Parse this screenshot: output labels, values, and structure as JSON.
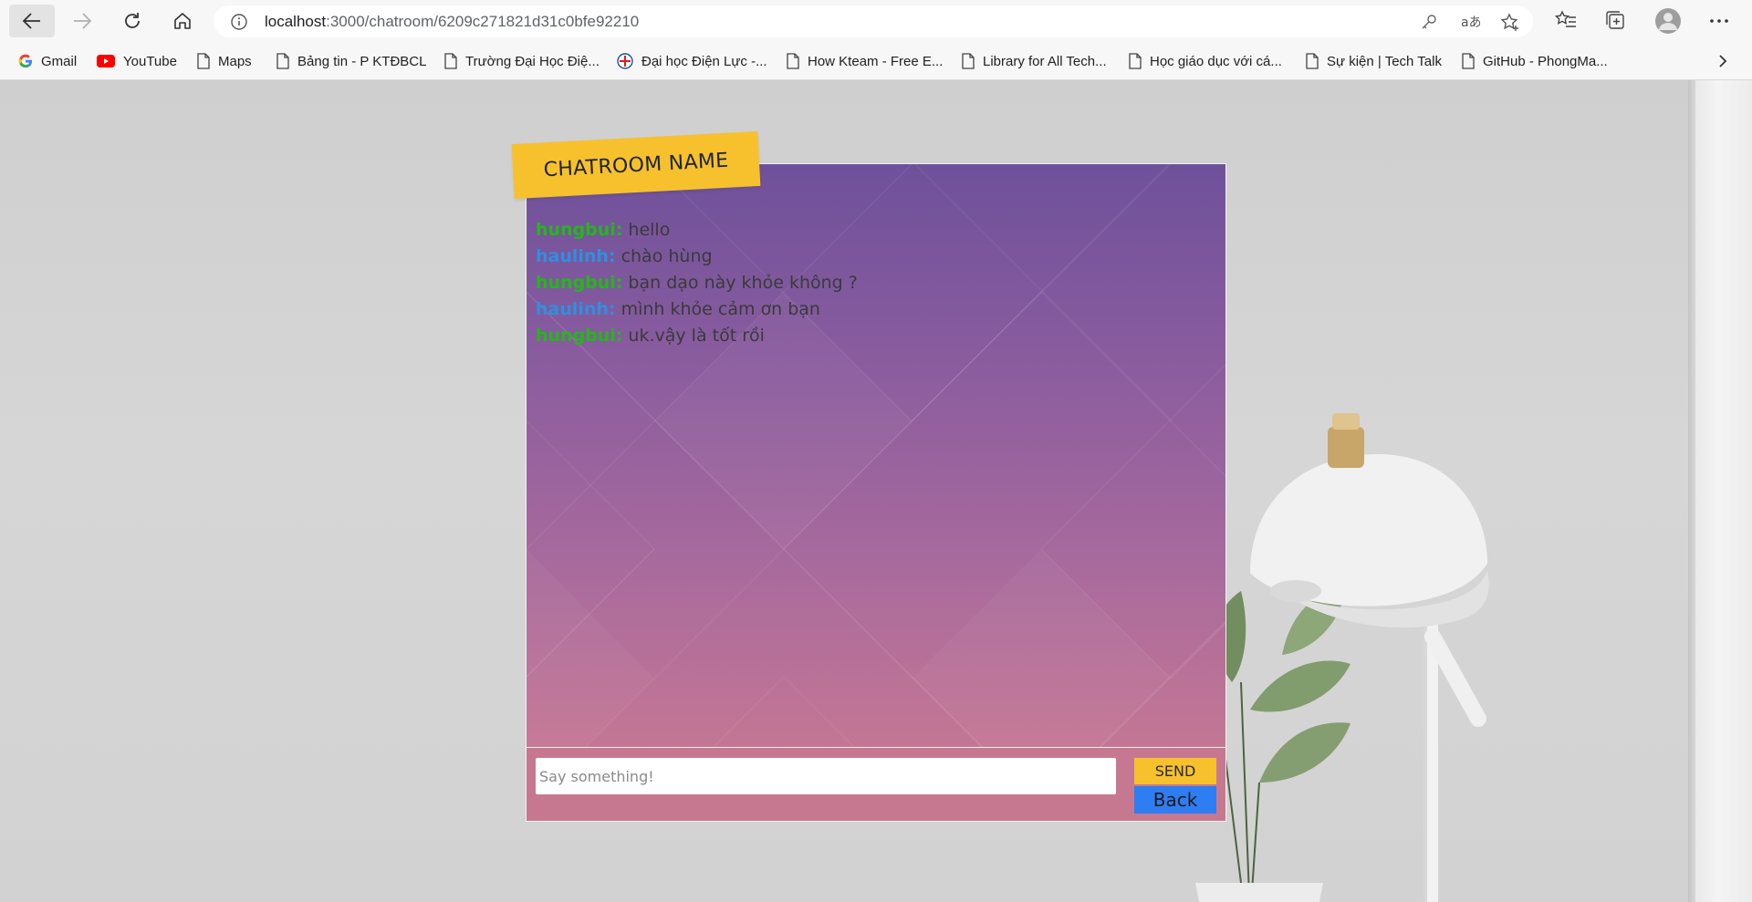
{
  "browser": {
    "url_host": "localhost",
    "url_path": ":3000/chatroom/6209c271821d31c0bfe92210"
  },
  "bookmarks": [
    {
      "label": "Gmail",
      "icon": "google-icon"
    },
    {
      "label": "YouTube",
      "icon": "youtube-icon"
    },
    {
      "label": "Maps",
      "icon": "page-icon"
    },
    {
      "label": "Bảng tin - P KTĐBCL",
      "icon": "page-icon"
    },
    {
      "label": "Trường Đại Học Điệ...",
      "icon": "page-icon"
    },
    {
      "label": "Đại học Điện Lực -...",
      "icon": "university-logo-icon"
    },
    {
      "label": "How Kteam - Free E...",
      "icon": "page-icon"
    },
    {
      "label": "Library for All Tech...",
      "icon": "page-icon"
    },
    {
      "label": "Học giáo dục với cá...",
      "icon": "page-icon"
    },
    {
      "label": "Sự kiện | Tech Talk",
      "icon": "page-icon"
    },
    {
      "label": "GitHub - PhongMa...",
      "icon": "page-icon"
    }
  ],
  "chat": {
    "room_name": "CHATROOM NAME",
    "messages": [
      {
        "user": "hungbui:",
        "text": "hello",
        "color": "#23b818"
      },
      {
        "user": "haulinh:",
        "text": "chào hùng",
        "color": "#2f8fe0"
      },
      {
        "user": "hungbui:",
        "text": "bạn dạo này khỏe không ?",
        "color": "#23b818"
      },
      {
        "user": "haulinh:",
        "text": "mình khỏe cảm ơn bạn",
        "color": "#2f8fe0"
      },
      {
        "user": "hungbui:",
        "text": "uk.vậy là tốt rồi",
        "color": "#23b818"
      }
    ],
    "input_placeholder": "Say something!",
    "send_label": "SEND",
    "back_label": "Back"
  },
  "colors": {
    "accent_yellow": "#f6c12d",
    "button_blue": "#2f7df3"
  }
}
